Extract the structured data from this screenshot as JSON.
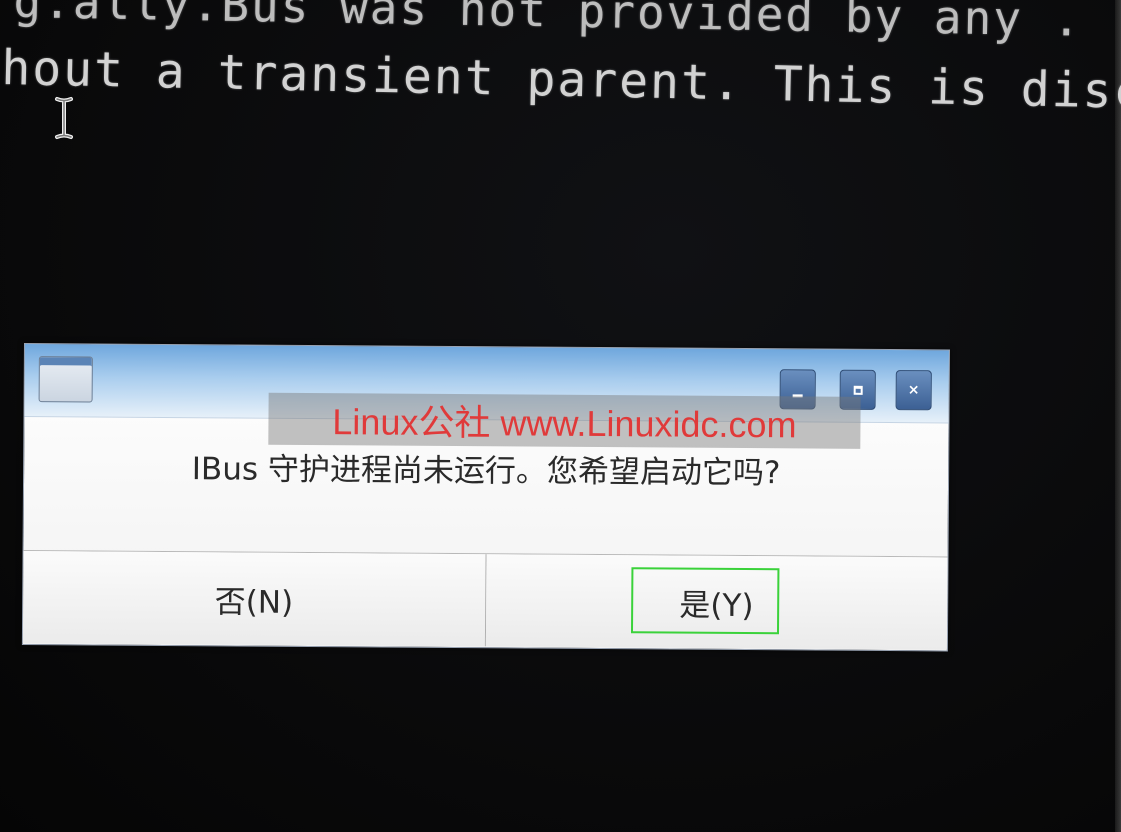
{
  "terminal": {
    "line1": "g.ally.Bus was not provided by any .",
    "line2": "hout a transient parent. This is disc"
  },
  "dialog": {
    "icon": "window-icon",
    "title_buttons": {
      "minimize": "minimize-icon",
      "maximize": "maximize-icon",
      "close": "×"
    },
    "watermark": "Linux公社 www.Linuxidc.com",
    "message": "IBus 守护进程尚未运行。您希望启动它吗?",
    "buttons": {
      "no": "否(N)",
      "yes": "是(Y)"
    },
    "focused_button": "yes",
    "focus_color": "#3ad23a",
    "titlebar_color": "#6fa7dd"
  }
}
